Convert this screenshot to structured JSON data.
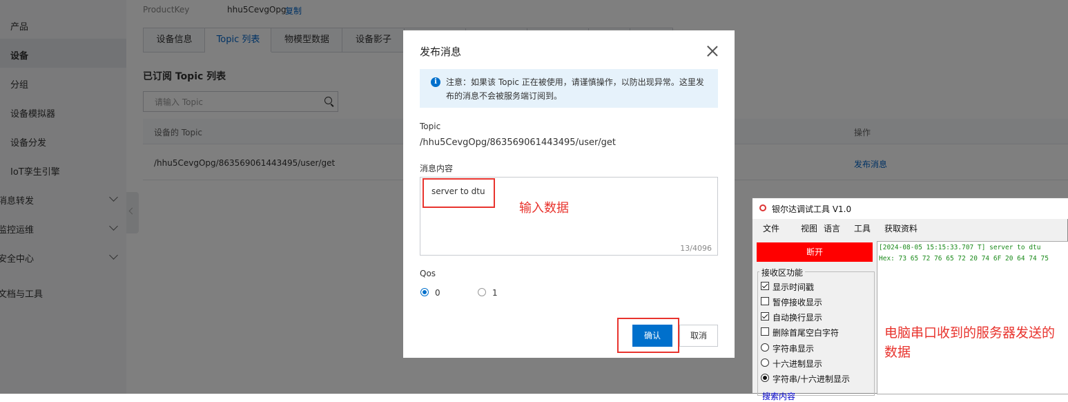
{
  "sidebar": {
    "items": [
      {
        "label": "产品"
      },
      {
        "label": "设备"
      },
      {
        "label": "分组"
      },
      {
        "label": "设备模拟器"
      },
      {
        "label": "设备分发"
      },
      {
        "label": "IoT孪生引擎"
      }
    ],
    "groups": [
      {
        "label": "消息转发"
      },
      {
        "label": "监控运维"
      },
      {
        "label": "安全中心"
      },
      {
        "label": "文档与工具"
      }
    ]
  },
  "product": {
    "key_label": "ProductKey",
    "key_value": "hhu5CevgOpg",
    "copy_label": "复制"
  },
  "tabs": [
    {
      "label": "设备信息"
    },
    {
      "label": "Topic 列表"
    },
    {
      "label": "物模型数据"
    },
    {
      "label": "设备影子"
    }
  ],
  "subscribed": {
    "title": "已订阅 Topic 列表",
    "search_placeholder": "请输入 Topic",
    "columns": {
      "topic": "设备的 Topic",
      "action": "操作"
    },
    "row": {
      "topic": "/hhu5CevgOpg/863569061443495/user/get",
      "action": "发布消息"
    }
  },
  "dialog": {
    "title": "发布消息",
    "notice": "注意：如果该 Topic 正在被使用，请谨慎操作，以防出现异常。这里发布的消息不会被服务端订阅到。",
    "topic_label": "Topic",
    "topic_value": "/hhu5CevgOpg/863569061443495/user/get",
    "content_label": "消息内容",
    "content_value": "server to dtu",
    "content_count": "13/4096",
    "qos_label": "Qos",
    "qos_options": [
      "0",
      "1"
    ],
    "qos_selected": "0",
    "confirm_label": "确认",
    "cancel_label": "取消",
    "annotation": "输入数据"
  },
  "serial_tool": {
    "title": "银尔达调试工具 V1.0",
    "menu": [
      "文件",
      "视图",
      "语言",
      "工具",
      "获取资料"
    ],
    "disconnect_label": "断开",
    "rx_group_title": "接收区功能",
    "options": [
      {
        "label": "显示时间戳",
        "type": "checkbox",
        "checked": true
      },
      {
        "label": "暂停接收显示",
        "type": "checkbox",
        "checked": false
      },
      {
        "label": "自动换行显示",
        "type": "checkbox",
        "checked": true
      },
      {
        "label": "删除首尾空白字符",
        "type": "checkbox",
        "checked": false
      },
      {
        "label": "字符串显示",
        "type": "radio",
        "checked": false
      },
      {
        "label": "十六进制显示",
        "type": "radio",
        "checked": false
      },
      {
        "label": "字符串/十六进制显示",
        "type": "radio",
        "checked": true
      }
    ],
    "more_label": "搜索内容",
    "rx_lines": [
      "[2024-08-05 15:15:33.707 T] server to dtu",
      "Hex: 73 65 72 76 65 72 20 74 6F 20 64 74 75"
    ],
    "annotation": "电脑串口收到的服务器发送的数据"
  },
  "colors": {
    "accent": "#0070cc",
    "annotation_red": "#e8332d",
    "disconnect_red": "#ff0000"
  }
}
